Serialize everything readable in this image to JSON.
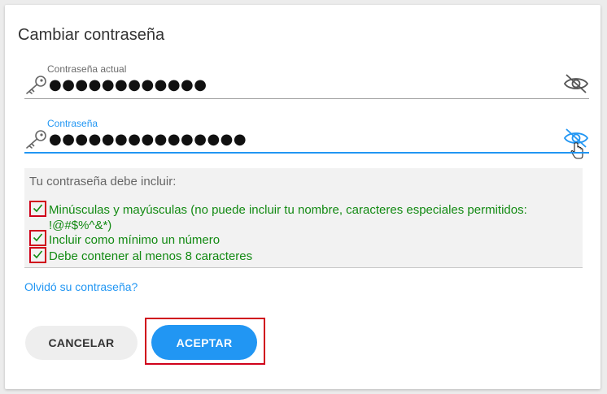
{
  "dialog": {
    "title": "Cambiar contraseña"
  },
  "current_password": {
    "label": "Contraseña actual",
    "value": "●●●●●●●●●●●●",
    "key_icon": "key-icon",
    "toggle_icon": "eye-off-icon"
  },
  "new_password": {
    "label": "Contraseña",
    "value": "●●●●●●●●●●●●●●●",
    "key_icon": "key-icon",
    "toggle_icon": "eye-off-icon",
    "focused": true,
    "accent_color": "#2196f3"
  },
  "requirements": {
    "heading": "Tu contraseña debe incluir:",
    "items": [
      {
        "text": "Minúsculas y mayúsculas (no puede incluir tu nombre, caracteres especiales permitidos: !@#$%^&*)",
        "met": true
      },
      {
        "text": "Incluir como mínimo un número",
        "met": true
      },
      {
        "text": "Debe contener al menos 8 caracteres",
        "met": true
      }
    ],
    "met_color": "#138a13"
  },
  "forgot_link": "Olvidó su contraseña?",
  "actions": {
    "cancel_label": "CANCELAR",
    "accept_label": "ACEPTAR",
    "primary_color": "#2196f3"
  },
  "annotation_color": "#d0021b"
}
